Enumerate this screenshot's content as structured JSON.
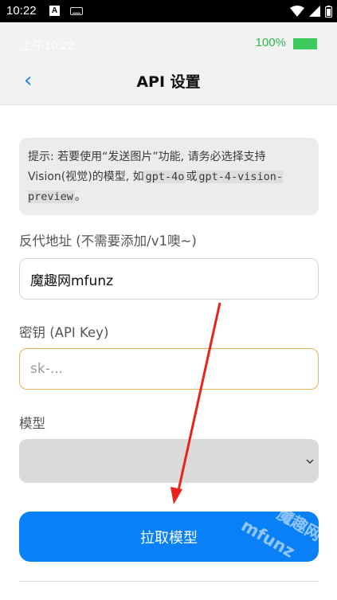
{
  "system_bar": {
    "time": "10:22",
    "icons": [
      "notification-a-icon",
      "keyboard-icon",
      "wifi-icon",
      "cellular-icon",
      "battery-icon"
    ]
  },
  "app_status": {
    "time": "上午10:22",
    "battery_percent": "100%"
  },
  "header": {
    "back_glyph": "‹",
    "title": "API 设置"
  },
  "hint": {
    "text_1": "提示: 若要使用“发送图片”功能, 请务必选择支持Vision(视觉)的模型, 如",
    "code_1": "gpt-4o",
    "text_2": "或",
    "code_2": "gpt-4-vision-preview",
    "text_3": "。"
  },
  "form": {
    "proxy_label": "反代地址 (不需要添加/v1噢~)",
    "proxy_value": "魔趣网mfunz",
    "api_key_label": "密钥 (API Key)",
    "api_key_placeholder": "sk-...",
    "model_label": "模型",
    "model_value": ""
  },
  "fetch_button": {
    "label": "拉取模型"
  },
  "watermark": {
    "line1": "魔趣网",
    "line2": "mfunz"
  },
  "colors": {
    "accent": "#0a80f7",
    "battery_green": "#3ccb5c",
    "focus_border": "#e6b25a",
    "annotation_arrow": "#e8231c"
  }
}
